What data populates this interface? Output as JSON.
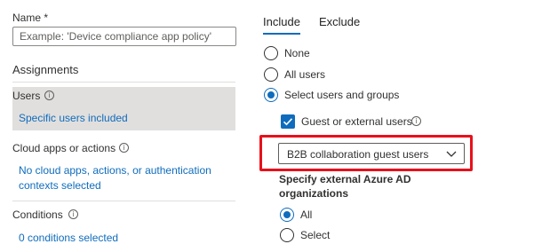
{
  "form": {
    "name_label": "Name *",
    "name_placeholder": "Example: 'Device compliance app policy'"
  },
  "assignments": {
    "heading": "Assignments",
    "users": {
      "label": "Users",
      "value": "Specific users included"
    },
    "cloud_apps": {
      "label": "Cloud apps or actions",
      "value_line1": "No cloud apps, actions, or authentication",
      "value_line2": "contexts selected"
    },
    "conditions": {
      "label": "Conditions",
      "value": "0 conditions selected"
    }
  },
  "tabs": [
    {
      "label": "Include",
      "selected": true
    },
    {
      "label": "Exclude",
      "selected": false
    }
  ],
  "include_options": {
    "none": "None",
    "all_users": "All users",
    "select_users": "Select users and groups",
    "selected": "select_users"
  },
  "guest": {
    "checkbox_label": "Guest or external users",
    "checked": true,
    "dropdown_value": "B2B collaboration guest users"
  },
  "external_orgs": {
    "heading_line1": "Specify external Azure AD",
    "heading_line2": "organizations",
    "all": "All",
    "select": "Select",
    "selected": "all"
  },
  "colors": {
    "accent": "#0f6cbd",
    "highlight_border": "#e8101a",
    "selected_row_bg": "#e1dfdd"
  }
}
